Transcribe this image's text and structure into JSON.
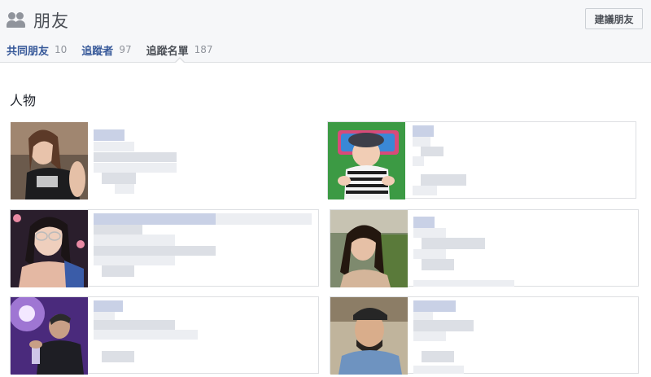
{
  "header": {
    "title": "朋友",
    "icon": "friends-icon",
    "suggest_button": "建議朋友"
  },
  "tabs": [
    {
      "label": "共同朋友",
      "count": "10"
    },
    {
      "label": "追蹤者",
      "count": "97"
    },
    {
      "label": "追蹤名單",
      "count": "187",
      "active": true
    }
  ],
  "section": {
    "title": "人物"
  },
  "people": [
    {
      "photo": "woman-black-top"
    },
    {
      "photo": "baby-striped"
    },
    {
      "photo": "woman-glasses"
    },
    {
      "photo": "woman-outdoor"
    },
    {
      "photo": "man-purple-light"
    },
    {
      "photo": "man-beard-cap"
    }
  ],
  "colors": {
    "link": "#365899",
    "header_bg": "#f6f7f9",
    "border": "#dddfe2",
    "muted": "#90949c"
  }
}
